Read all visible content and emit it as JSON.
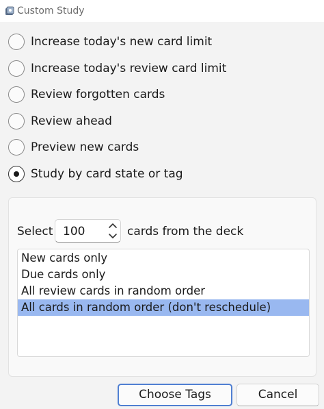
{
  "window": {
    "title": "Custom Study",
    "app_icon": "anki-app-icon"
  },
  "options": [
    {
      "label": "Increase today's new card limit",
      "checked": false
    },
    {
      "label": "Increase today's review card limit",
      "checked": false
    },
    {
      "label": "Review forgotten cards",
      "checked": false
    },
    {
      "label": "Review ahead",
      "checked": false
    },
    {
      "label": "Preview new cards",
      "checked": false
    },
    {
      "label": "Study by card state or tag",
      "checked": true
    }
  ],
  "study_panel": {
    "select_label": "Select",
    "count_value": "100",
    "suffix_label": "cards from the deck",
    "list_items": [
      "New cards only",
      "Due cards only",
      "All review cards in random order",
      "All cards in random order (don't reschedule)"
    ],
    "selected_index": 3
  },
  "buttons": {
    "choose_tags": "Choose Tags",
    "cancel": "Cancel"
  },
  "colors": {
    "selection": "#99b8f0",
    "focus_border": "#4f7fd2"
  }
}
